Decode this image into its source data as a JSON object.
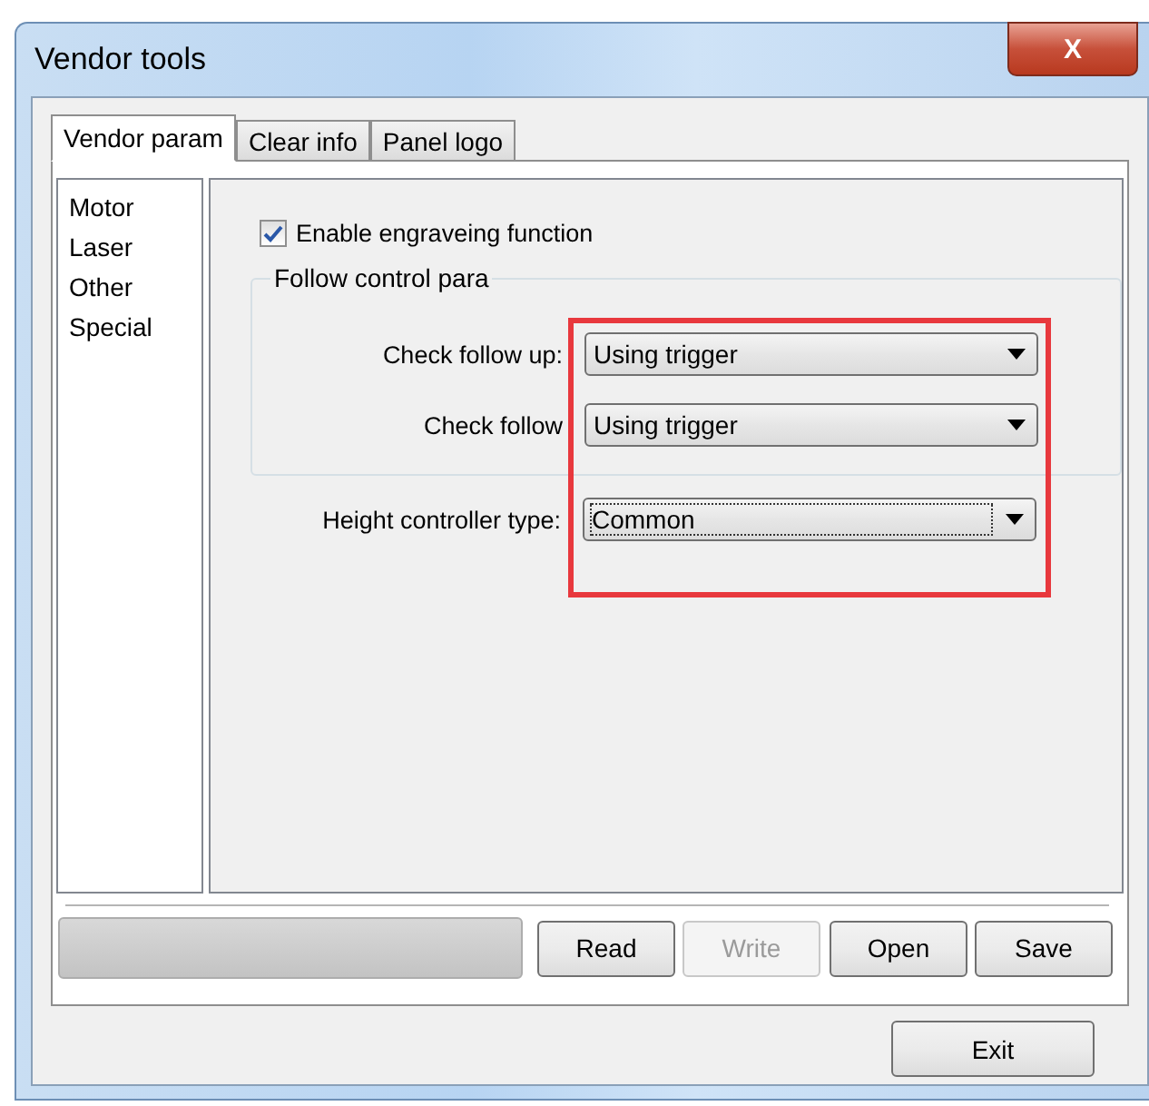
{
  "window": {
    "title": "Vendor tools",
    "close_icon": "X"
  },
  "tabs": [
    {
      "label": "Vendor param",
      "selected": true
    },
    {
      "label": "Clear info",
      "selected": false
    },
    {
      "label": "Panel logo",
      "selected": false
    }
  ],
  "sidebar": {
    "items": [
      {
        "label": "Motor",
        "selected": false
      },
      {
        "label": "Laser",
        "selected": false
      },
      {
        "label": "Other",
        "selected": false
      },
      {
        "label": "Special",
        "selected": false
      }
    ]
  },
  "enable_checkbox": {
    "label": "Enable engraveing function",
    "checked": true
  },
  "follow_group": {
    "title": "Follow control para",
    "fields": [
      {
        "label": "Check follow up:",
        "value": "Using trigger",
        "focused": false
      },
      {
        "label": "Check follow",
        "value": "Using trigger",
        "focused": false
      }
    ]
  },
  "height_field": {
    "label": "Height controller type:",
    "value": "Common",
    "focused": true
  },
  "progress": {
    "level": 0
  },
  "buttons": [
    {
      "label": "Read",
      "disabled": false
    },
    {
      "label": "Write",
      "disabled": true
    },
    {
      "label": "Open",
      "disabled": false
    },
    {
      "label": "Save",
      "disabled": false
    }
  ],
  "exit_button": {
    "label": "Exit"
  }
}
